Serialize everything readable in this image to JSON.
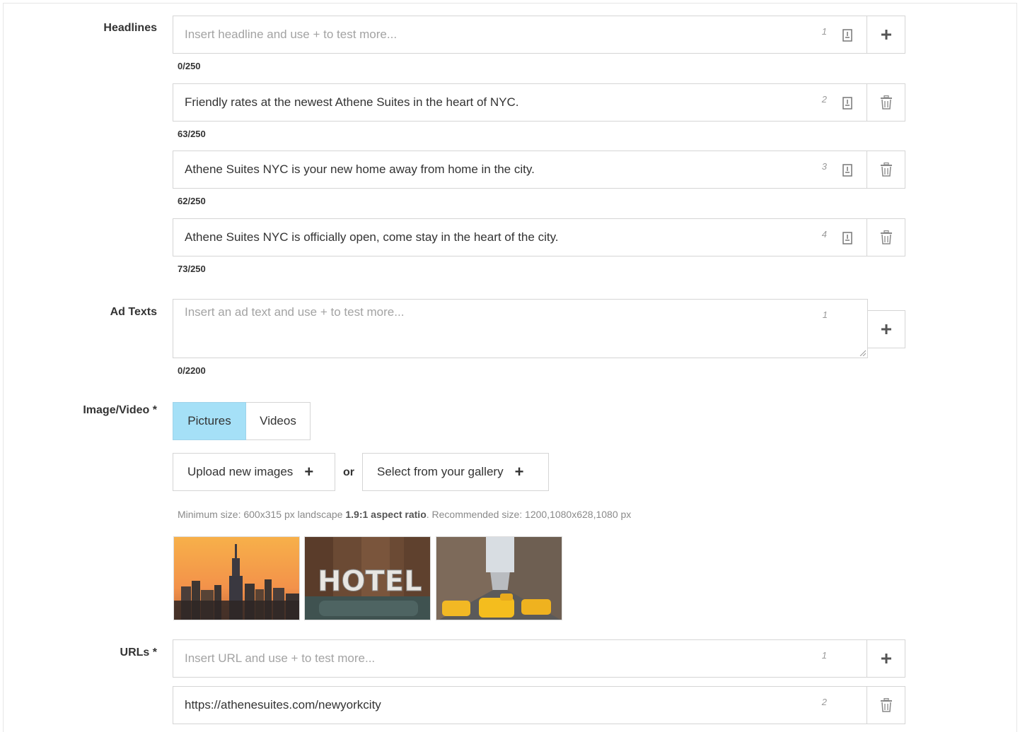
{
  "headlines": {
    "label": "Headlines",
    "items": [
      {
        "value": "",
        "placeholder": "Insert headline and use + to test more...",
        "number": "1",
        "counter": "0/250",
        "action": "add"
      },
      {
        "value": "Friendly rates at the newest Athene Suites in the heart of NYC.",
        "placeholder": "",
        "number": "2",
        "counter": "63/250",
        "action": "delete"
      },
      {
        "value": "Athene Suites NYC is your new home away from home in the city.",
        "placeholder": "",
        "number": "3",
        "counter": "62/250",
        "action": "delete"
      },
      {
        "value": "Athene Suites NYC is officially open, come stay in the heart of the city.",
        "placeholder": "",
        "number": "4",
        "counter": "73/250",
        "action": "delete"
      }
    ]
  },
  "ad_texts": {
    "label": "Ad Texts",
    "placeholder": "Insert an ad text and use + to test more...",
    "number": "1",
    "counter": "0/2200"
  },
  "media": {
    "label": "Image/Video *",
    "tabs": [
      {
        "label": "Pictures",
        "active": true
      },
      {
        "label": "Videos",
        "active": false
      }
    ],
    "upload_label": "Upload new images",
    "or_label": "or",
    "gallery_label": "Select from your gallery",
    "hint_prefix": "Minimum size: 600x315 px landscape",
    "hint_bold": "1.9:1 aspect ratio",
    "hint_suffix": ". Recommended size: 1200,1080x628,1080 px",
    "thumbnails": [
      "city-skyline-image",
      "hotel-sign-image",
      "street-taxis-image"
    ]
  },
  "urls": {
    "label": "URLs *",
    "items": [
      {
        "value": "",
        "placeholder": "Insert URL and use + to test more...",
        "number": "1",
        "action": "add"
      },
      {
        "value": "https://athenesuites.com/newyorkcity",
        "placeholder": "",
        "number": "2",
        "action": "delete"
      }
    ]
  },
  "colors": {
    "active_tab": "#a5e0f7",
    "border": "#d5d5d5",
    "placeholder": "#a3a3a3"
  }
}
